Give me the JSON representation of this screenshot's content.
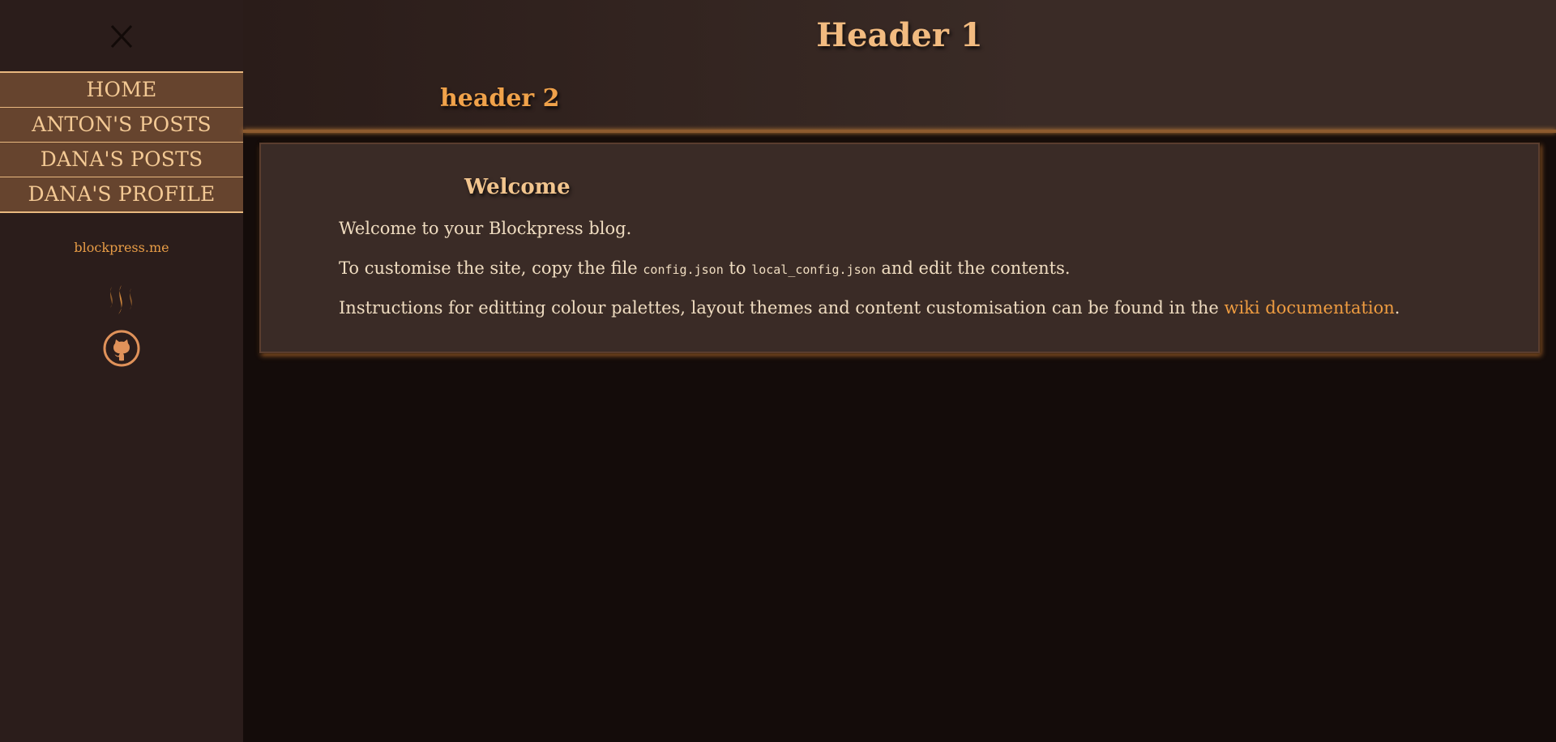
{
  "sidebar": {
    "nav_items": [
      {
        "label": "HOME"
      },
      {
        "label": "ANTON'S POSTS"
      },
      {
        "label": "DANA'S POSTS"
      },
      {
        "label": "DANA'S PROFILE"
      }
    ],
    "site_link": "blockpress.me",
    "icons": {
      "close": "close-icon",
      "steem": "steem-icon",
      "github": "github-icon"
    }
  },
  "header": {
    "title": "Header 1",
    "subtitle": "header 2"
  },
  "welcome": {
    "title": "Welcome",
    "line1": "Welcome to your Blockpress blog.",
    "line2_prefix": "To customise the site, copy the file ",
    "line2_code1": "config.json",
    "line2_mid": " to ",
    "line2_code2": "local_config.json",
    "line2_suffix": " and edit the contents.",
    "line3_prefix": "Instructions for editting colour palettes, layout themes and content customisation can be found in the ",
    "line3_link": "wiki documentation",
    "line3_suffix": "."
  },
  "colors": {
    "accent": "#e79c46",
    "nav_bg": "#66442e",
    "sidebar_bg": "#2b1d1b",
    "page_bg": "#140c0a",
    "card_bg": "#3a2b26"
  }
}
